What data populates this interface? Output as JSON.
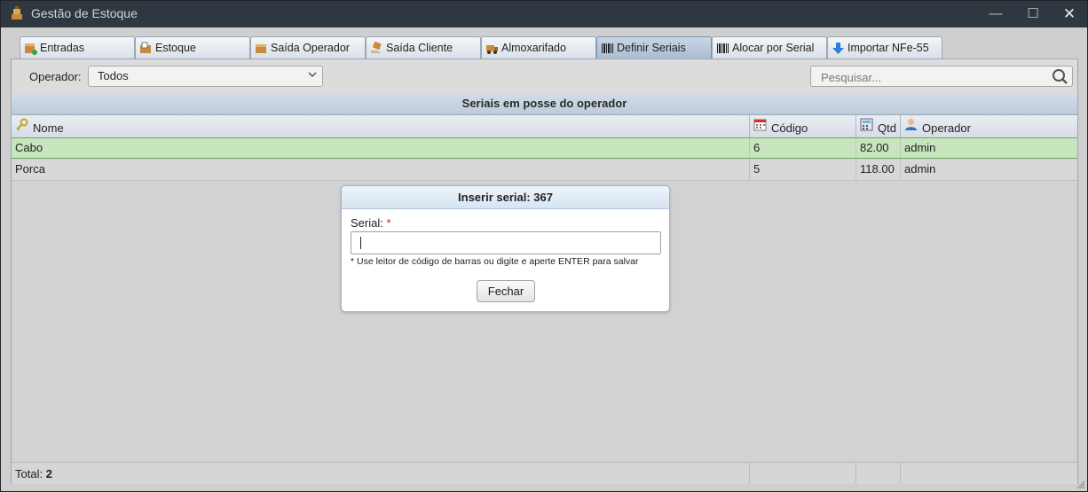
{
  "window": {
    "title": "Gestão de Estoque",
    "controls": {
      "minimize": "—",
      "maximize": "☐",
      "close": "✕"
    }
  },
  "tabs": [
    {
      "label": "Entradas",
      "icon": "box-add-icon"
    },
    {
      "label": "Estoque",
      "icon": "box-list-icon"
    },
    {
      "label": "Saída Operador",
      "icon": "box-out-icon"
    },
    {
      "label": "Saída Cliente",
      "icon": "hand-box-icon"
    },
    {
      "label": "Almoxarifado",
      "icon": "truck-icon"
    },
    {
      "label": "Definir Seriais",
      "icon": "barcode-icon",
      "active": true
    },
    {
      "label": "Alocar por Serial",
      "icon": "barcode-icon"
    },
    {
      "label": "Importar NFe-55",
      "icon": "download-arrow-icon"
    }
  ],
  "toolbar": {
    "operator_label": "Operador:",
    "operator_value": "Todos",
    "search_placeholder": "Pesquisar..."
  },
  "grid": {
    "title": "Seriais em posse do operador",
    "columns": [
      {
        "label": "Nome",
        "icon": "key-icon"
      },
      {
        "label": "Código",
        "icon": "calendar-icon"
      },
      {
        "label": "Qtd",
        "icon": "calculator-icon"
      },
      {
        "label": "Operador",
        "icon": "user-icon"
      }
    ],
    "rows": [
      {
        "nome": "Cabo",
        "codigo": "6",
        "qtd": "82.00",
        "operador": "admin",
        "selected": true
      },
      {
        "nome": "Porca",
        "codigo": "5",
        "qtd": "118.00",
        "operador": "admin",
        "selected": false
      }
    ],
    "footer": {
      "total_label": "Total:",
      "total_value": "2"
    }
  },
  "dialog": {
    "title": "Inserir serial: 367",
    "field_label": "Serial:",
    "required_mark": "*",
    "hint": "* Use leitor de código de barras ou digite e aperte ENTER para salvar",
    "close_button": "Fechar"
  },
  "colors": {
    "titlebar": "#2f3740",
    "selected_row": "#c7e6bd",
    "active_tab": "#a9bdd2",
    "required": "#cc2222"
  }
}
